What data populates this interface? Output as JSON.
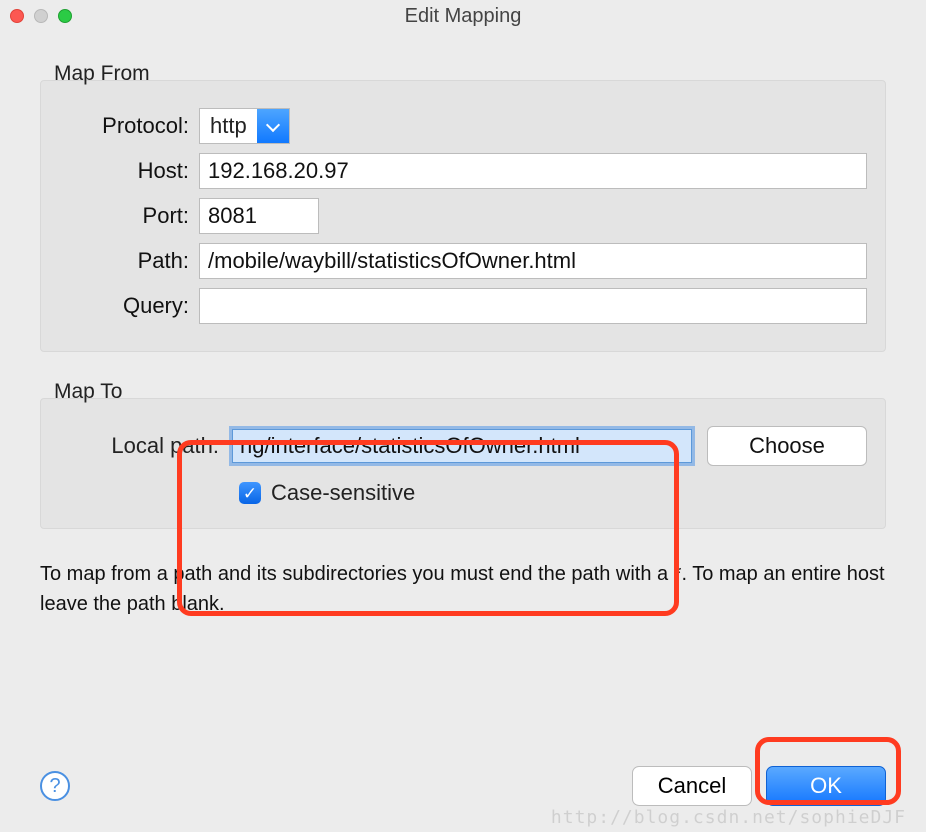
{
  "window": {
    "title": "Edit Mapping"
  },
  "mapFrom": {
    "legend": "Map From",
    "protocolLabel": "Protocol:",
    "protocolValue": "http",
    "hostLabel": "Host:",
    "hostValue": "192.168.20.97",
    "portLabel": "Port:",
    "portValue": "8081",
    "pathLabel": "Path:",
    "pathValue": "/mobile/waybill/statisticsOfOwner.html",
    "queryLabel": "Query:",
    "queryValue": ""
  },
  "mapTo": {
    "legend": "Map To",
    "localPathLabel": "Local path:",
    "localPathValue": "ng/interface/statisticsOfOwner.html",
    "chooseLabel": "Choose",
    "caseSensitiveLabel": "Case-sensitive",
    "caseSensitiveChecked": true
  },
  "hint": "To map from a path and its subdirectories you must end the path with a *. To map an entire host leave the path blank.",
  "footer": {
    "helpGlyph": "?",
    "cancelLabel": "Cancel",
    "okLabel": "OK"
  },
  "watermark": "http://blog.csdn.net/sophieDJF"
}
